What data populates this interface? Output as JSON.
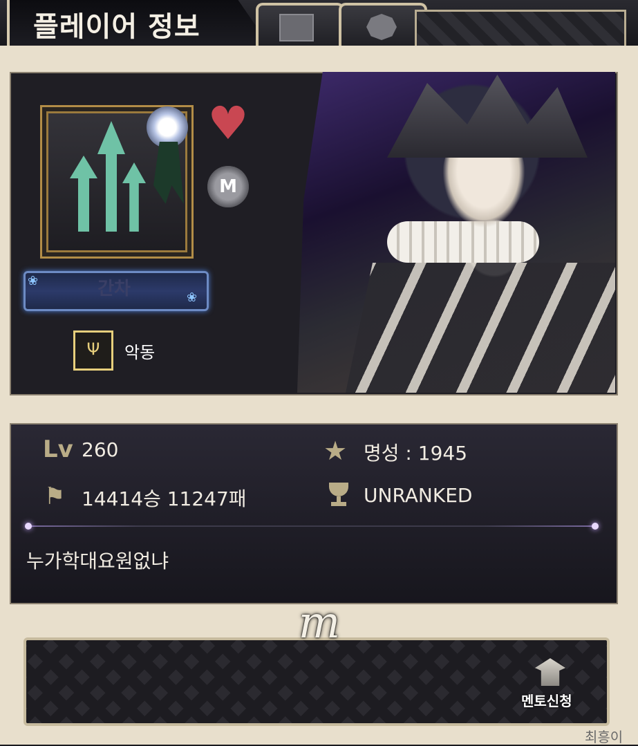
{
  "window": {
    "title": "플레이어 정보"
  },
  "tabs": [
    {
      "icon": "cards-icon"
    },
    {
      "icon": "badge-icon"
    }
  ],
  "profile": {
    "gacha_label": "간차",
    "title_badge_icon": "trident-icon",
    "title_text": "악동",
    "heart_icon": "heart-icon",
    "medal_icon": "mentor-medal-icon",
    "medal_letter": "M"
  },
  "stats": {
    "level_icon": "Lv",
    "level_value": "260",
    "fame_text": "명성 : 1945",
    "record_text": "14414승 11247패",
    "rank_text": "UNRANKED"
  },
  "motto": "누가학대요원없냐",
  "footer": {
    "emblem_letter": "m",
    "mentor_label": "멘토신청",
    "corner_text": "최흥이"
  },
  "colors": {
    "frame": "#e8dfcc",
    "panel": "#1f1e24",
    "heart": "#c94752",
    "accent_gold": "#e7cf7c"
  }
}
